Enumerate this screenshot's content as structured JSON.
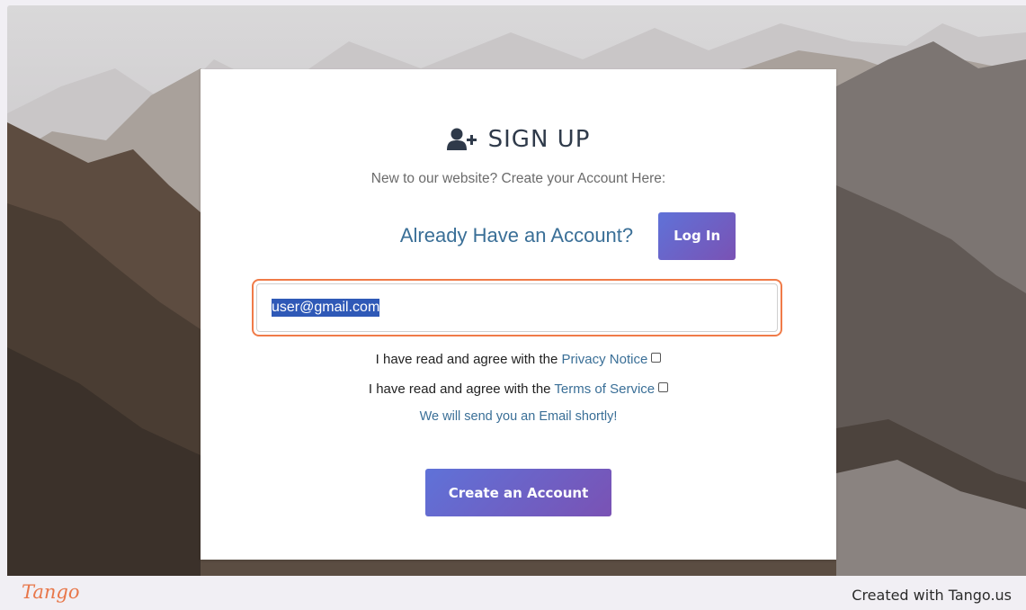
{
  "signup": {
    "title": "SIGN UP",
    "subtitle": "New to our website? Create your Account Here:",
    "already_label": "Already Have an Account?",
    "login_label": "Log In",
    "email_value": "user@gmail.com",
    "privacy_prefix": "I have read and agree with the ",
    "privacy_link": "Privacy Notice",
    "terms_prefix": "I have read and agree with the ",
    "terms_link": "Terms of Service",
    "note": "We will send you an Email shortly!",
    "create_label": "Create an Account"
  },
  "footer": {
    "brand": "Tango",
    "credit": "Created with Tango.us"
  },
  "icons": {
    "title_icon": "user-plus-icon"
  },
  "colors": {
    "accent_link": "#3a6f97",
    "button_gradient_start": "#5f72d8",
    "button_gradient_end": "#7a52b4",
    "highlight_border": "#f07b48",
    "brand": "#e8774a"
  }
}
